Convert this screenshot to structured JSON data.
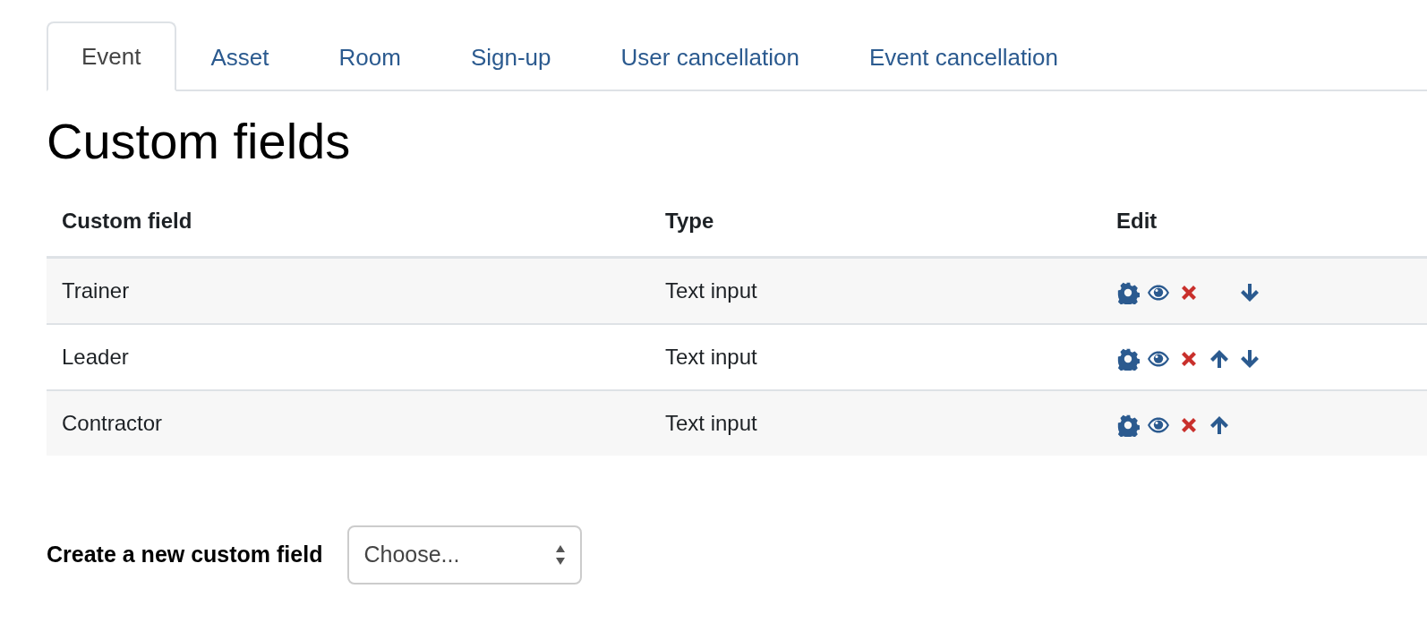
{
  "tabs": [
    {
      "label": "Event",
      "selected": true
    },
    {
      "label": "Asset",
      "selected": false
    },
    {
      "label": "Room",
      "selected": false
    },
    {
      "label": "Sign-up",
      "selected": false
    },
    {
      "label": "User cancellation",
      "selected": false
    },
    {
      "label": "Event cancellation",
      "selected": false
    }
  ],
  "heading": "Custom fields",
  "table": {
    "columns": [
      "Custom field",
      "Type",
      "Edit"
    ],
    "rows": [
      {
        "name": "Trainer",
        "type": "Text input",
        "can_move_up": false,
        "can_move_down": true
      },
      {
        "name": "Leader",
        "type": "Text input",
        "can_move_up": true,
        "can_move_down": true
      },
      {
        "name": "Contractor",
        "type": "Text input",
        "can_move_up": true,
        "can_move_down": false
      }
    ]
  },
  "create": {
    "label": "Create a new custom field",
    "placeholder": "Choose..."
  }
}
